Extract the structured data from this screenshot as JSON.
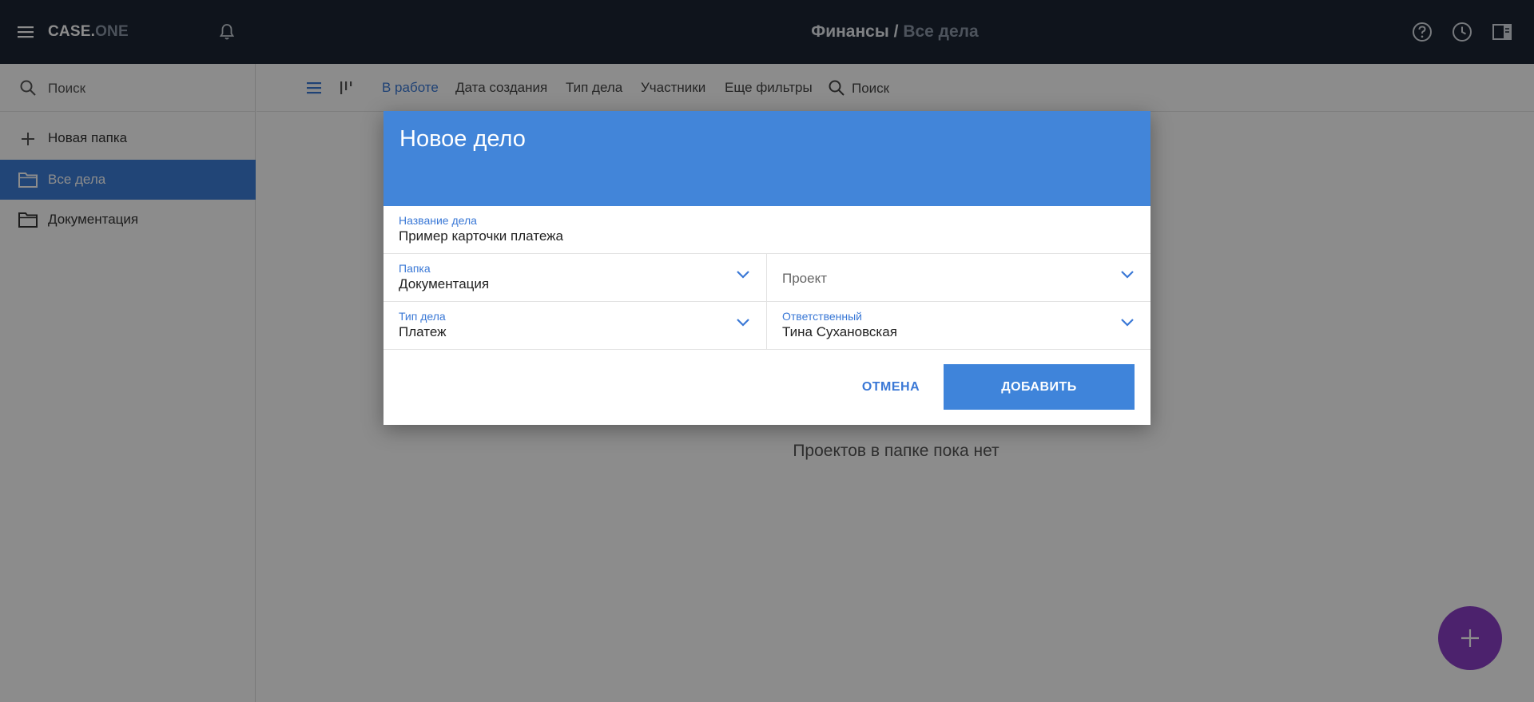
{
  "app": {
    "logo_bold": "CASE.",
    "logo_light": "ONE"
  },
  "header": {
    "breadcrumb_root": "Финансы",
    "breadcrumb_separator": "/",
    "breadcrumb_current": "Все дела"
  },
  "sidebar": {
    "search_placeholder": "Поиск",
    "new_folder_label": "Новая папка",
    "items": [
      {
        "label": "Все дела",
        "active": true
      },
      {
        "label": "Документация",
        "active": false
      }
    ]
  },
  "toolbar": {
    "filters": [
      {
        "label": "В работе",
        "active": true
      },
      {
        "label": "Дата создания",
        "active": false
      },
      {
        "label": "Тип дела",
        "active": false
      },
      {
        "label": "Участники",
        "active": false
      },
      {
        "label": "Еще фильтры",
        "active": false
      }
    ],
    "search_label": "Поиск"
  },
  "main": {
    "empty_message": "Проектов в папке пока нет"
  },
  "dialog": {
    "title": "Новое дело",
    "fields": {
      "name": {
        "label": "Название дела",
        "value": "Пример карточки платежа"
      },
      "folder": {
        "label": "Папка",
        "value": "Документация"
      },
      "project": {
        "placeholder": "Проект"
      },
      "type": {
        "label": "Тип дела",
        "value": "Платеж"
      },
      "responsible": {
        "label": "Ответственный",
        "value": "Тина Сухановская"
      }
    },
    "cancel_label": "ОТМЕНА",
    "add_label": "ДОБАВИТЬ"
  },
  "colors": {
    "topbar": "#1c2633",
    "accent": "#4285d9",
    "fab": "#8a3fc6"
  }
}
